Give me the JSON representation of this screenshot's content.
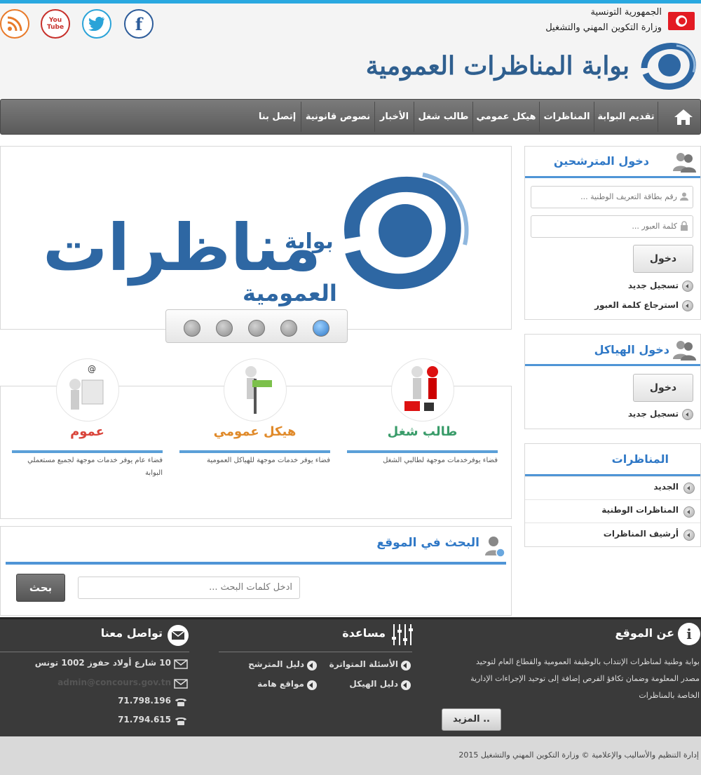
{
  "header": {
    "country": "الجمهورية التونسية",
    "ministry": "وزارة التكوين المهني والتشغيل",
    "portal_title": "بوابة المناظرات العمومية",
    "social": [
      "facebook-icon",
      "twitter-icon",
      "youtube-icon",
      "rss-icon"
    ],
    "youtube_label": "You Tube"
  },
  "nav": {
    "items": [
      "تقديم البوابة",
      "المناظرات",
      "هيكل عمومي",
      "طالب شغل",
      "الأخبار",
      "نصوص قانونية",
      "إتصل بنا"
    ]
  },
  "slider": {
    "logo_small": "بوابة",
    "logo_main": "مناظرات",
    "logo_sub": "العمومية",
    "dots": 5,
    "active_dot": 5
  },
  "services": [
    {
      "title": "طالب شغل",
      "desc": "فضاء يوفرخدمات موجهة لطالبي الشغل",
      "color": "#3a9c6a"
    },
    {
      "title": "هيكل عمومي",
      "desc": "فضاء يوفر خدمات موجهة للهياكل العمومية",
      "color": "#e08a2a"
    },
    {
      "title": "عموم",
      "desc": "فضاء عام يوفر خدمات موجهة لجميع مستعملي البوابة",
      "color": "#d9443a"
    }
  ],
  "search": {
    "title": "البحث في الموقع",
    "placeholder": "ادخل كلمات البحث ...",
    "button": "بحث"
  },
  "candidate_login": {
    "title": "دخول المترشحين",
    "id_placeholder": "رقم بطاقة التعريف الوطنية ...",
    "password_placeholder": "كلمة العبور ...",
    "button": "دخول",
    "register": "تسجيل جديد",
    "recover": "استرجاع كلمة العبور"
  },
  "structure_login": {
    "title": "دخول الهياكل",
    "button": "دخول",
    "register": "تسجيل جديد"
  },
  "competitions": {
    "title": "المناظرات",
    "items": [
      "الجديد",
      "المناظرات الوطنية",
      "أرشيف المناظرات"
    ]
  },
  "footer": {
    "about_title": "عن الموقع",
    "about_text_1": "بوابة وطنية لمناظرات الإنتداب بالوظيفة العمومية والقطاع العام لتوحيد",
    "about_text_2": "مصدر المعلومة وضمان تكافؤ الفرص إضافة إلى توحيد الإجراءات الإدارية",
    "about_text_3": "الخاصة بالمناظرات",
    "more_button": "المزيد ..",
    "help_title": "مساعدة",
    "help_links": [
      "الأسئلة المتواترة",
      "دليل المترشح",
      "دليل الهيكل",
      "مواقع هامة"
    ],
    "contact_title": "تواصل معنا",
    "address": "10 شارع أولاد حفوز 1002 تونس",
    "email": "admin@concours.gov.tn",
    "phone1": "71.798.196",
    "phone2": "71.794.615"
  },
  "copyright": "إدارة التنظيم والأساليب والإعلامية © وزارة التكوين المهني والتشغيل 2015"
}
